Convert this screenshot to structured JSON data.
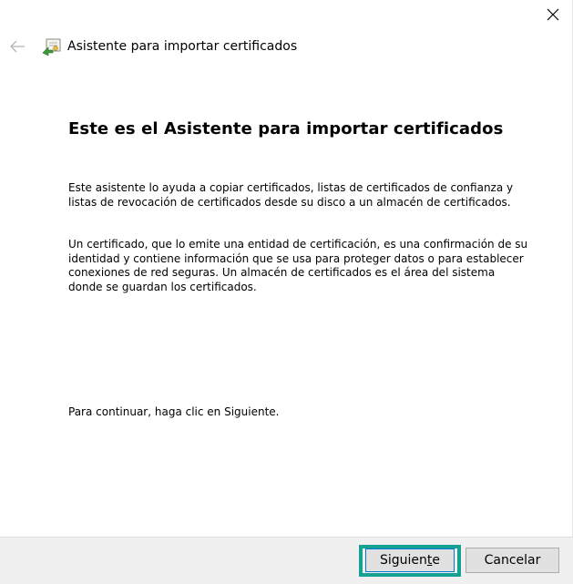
{
  "window": {
    "title": "Asistente para importar certificados"
  },
  "content": {
    "heading": "Este es el Asistente para importar certificados",
    "paragraph1": "Este asistente lo ayuda a copiar certificados, listas de certificados de confianza y listas de revocación de certificados desde su disco a un almacén de certificados.",
    "paragraph2": "Un certificado, que lo emite una entidad de certificación, es una confirmación de su identidad y contiene información que se usa para proteger datos o para establecer conexiones de red seguras. Un almacén de certificados es el área del sistema donde se guardan los certificados.",
    "paragraph3": "Para continuar, haga clic en Siguiente."
  },
  "buttons": {
    "next_pre": "Siguien",
    "next_mnemonic": "t",
    "next_post": "e",
    "cancel": "Cancelar"
  },
  "colors": {
    "highlight": "#16a192",
    "focus_border": "#0078d7",
    "footer_bg": "#f0f0f0"
  },
  "icons": {
    "close": "close-icon",
    "back": "back-arrow-icon",
    "wizard": "certificate-import-icon"
  }
}
